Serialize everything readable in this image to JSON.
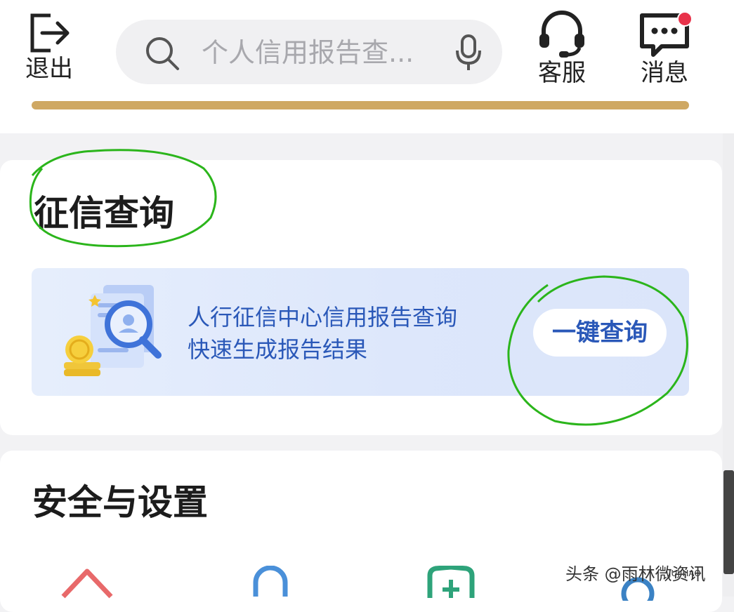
{
  "header": {
    "exit_label": "退出",
    "search_placeholder": "个人信用报告查...",
    "service_label": "客服",
    "message_label": "消息"
  },
  "credit_section": {
    "title": "征信查询",
    "banner_line1": "人行征信中心信用报告查询",
    "banner_line2": "快速生成报告结果",
    "query_button": "一键查询"
  },
  "security_section": {
    "title": "安全与设置",
    "icons": [
      "home-icon",
      "lock-icon",
      "shield-plus-icon",
      "settings-icon"
    ]
  },
  "watermark": {
    "text": "头条 @雨林微资讯",
    "logo": "JUJIHAO"
  },
  "colors": {
    "accent_blue": "#2a58b8",
    "gold_bar": "#cfa863",
    "badge_red": "#e8324a",
    "annotation_green": "#2bb51b"
  }
}
